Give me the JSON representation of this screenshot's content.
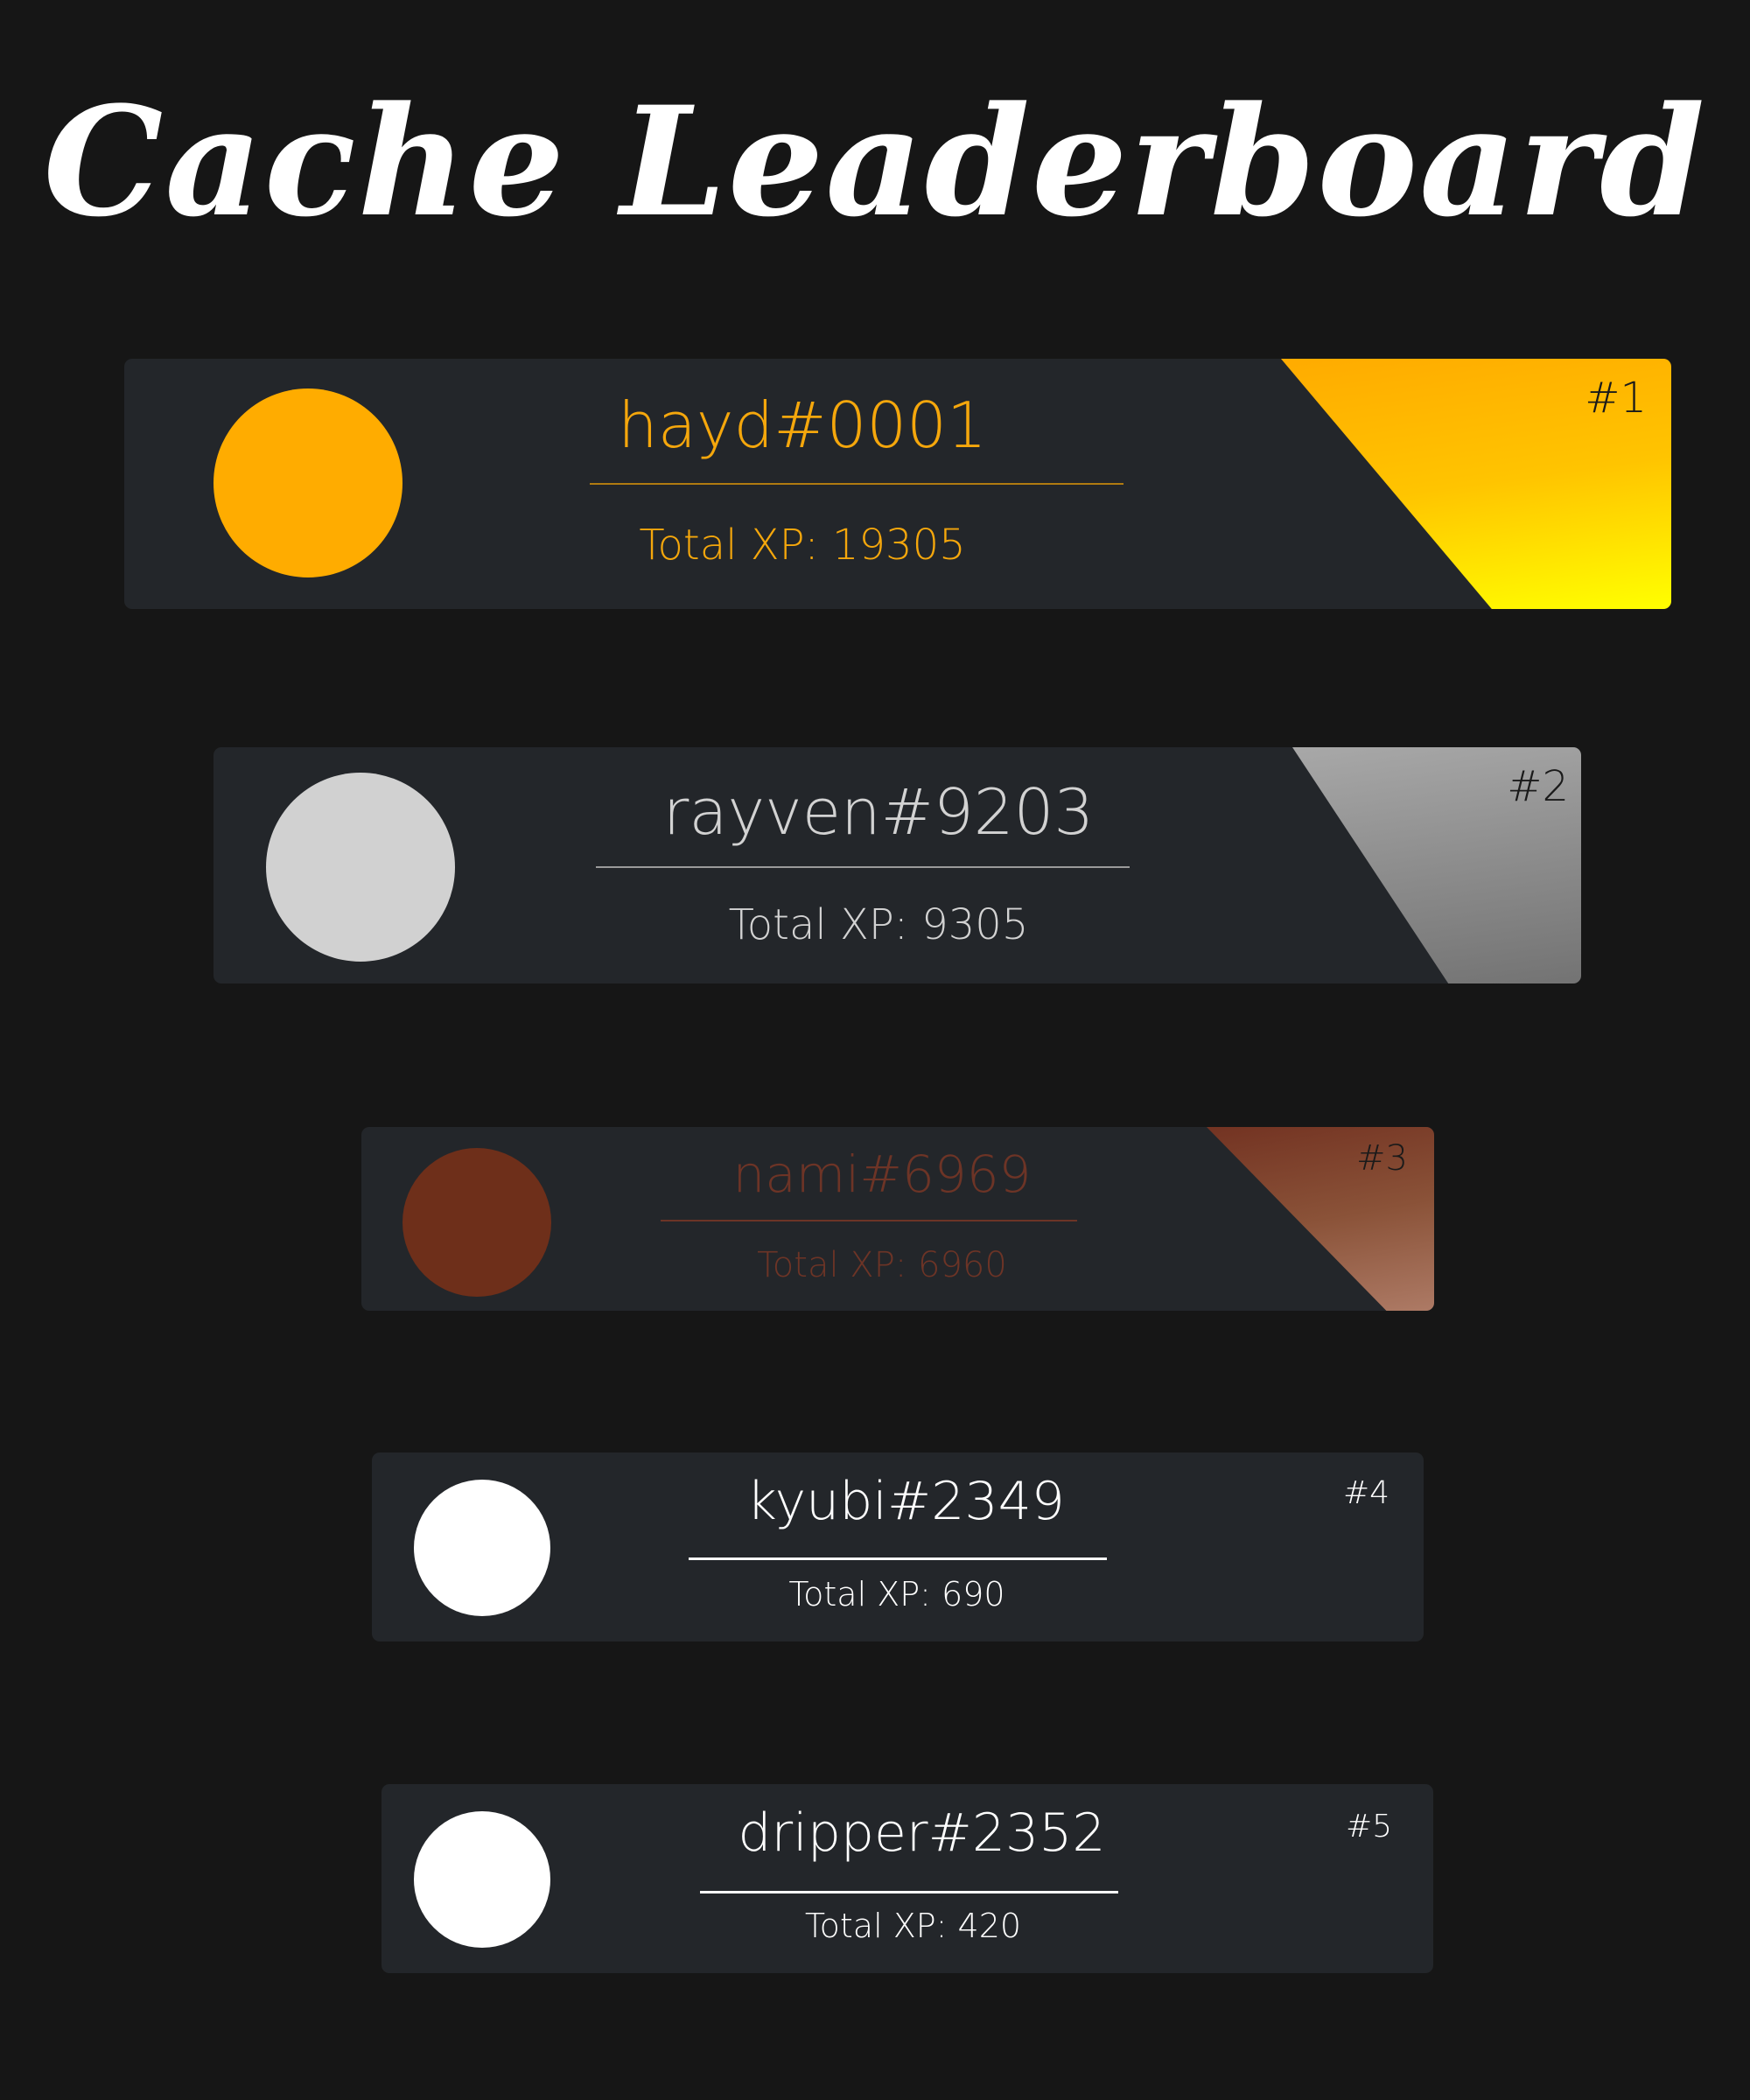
{
  "page": {
    "title": "Cache Leaderboard",
    "background": "#161616",
    "card_background": "#23262a"
  },
  "leaderboard": {
    "entries": [
      {
        "rank": "#1",
        "username": "hayd#0001",
        "total_xp": "Total XP: 19305",
        "avatar_color": "#ffac00",
        "text_color": "#f5a70c",
        "accent_gradient": [
          "#ffab00",
          "#ffff00"
        ]
      },
      {
        "rank": "#2",
        "username": "rayven#9203",
        "total_xp": "Total XP: 9305",
        "avatar_color": "#d1d1d1",
        "text_color": "#d2d2d2",
        "accent_gradient": [
          "#a8a8a8",
          "#737373"
        ]
      },
      {
        "rank": "#3",
        "username": "nami#6969",
        "total_xp": "Total XP: 6960",
        "avatar_color": "#6e2f1a",
        "text_color": "#6d3426",
        "accent_gradient": [
          "#733322",
          "#ad7a65"
        ]
      },
      {
        "rank": "#4",
        "username": "kyubi#2349",
        "total_xp": "Total XP: 690",
        "avatar_color": "#ffffff",
        "text_color": "#ffffff"
      },
      {
        "rank": "#5",
        "username": "dripper#2352",
        "total_xp": "Total XP: 420",
        "avatar_color": "#ffffff",
        "text_color": "#ffffff"
      }
    ]
  }
}
